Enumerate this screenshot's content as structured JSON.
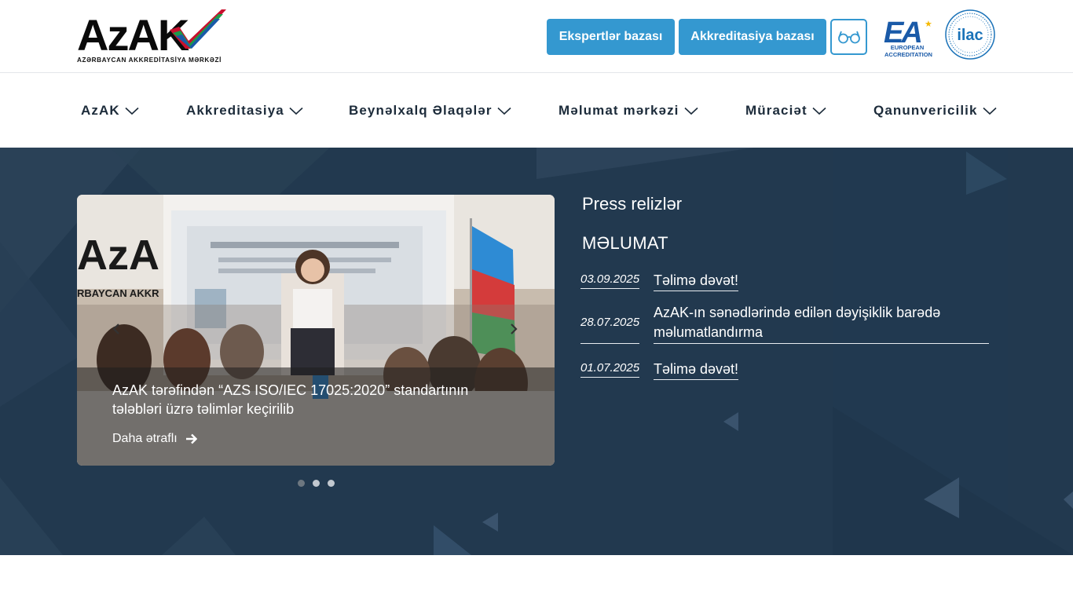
{
  "header": {
    "logo_text": "AzAK",
    "logo_subtitle": "AZƏRBAYCAN AKKREDİTASİYA MƏRKƏZİ",
    "experts_button": "Ekspertlər bazası",
    "accreditation_button": "Akkreditasiya bazası",
    "ea_logo": {
      "mark": "EA",
      "line1": "EUROPEAN",
      "line2": "ACCREDITATION"
    },
    "ilac_logo": "ilac",
    "accessibility_icon": "glasses-icon"
  },
  "nav": {
    "items": [
      {
        "label": "AzAK"
      },
      {
        "label": "Akkreditasiya"
      },
      {
        "label": "Beynəlxalq Əlaqələr"
      },
      {
        "label": "Məlumat mərkəzi"
      },
      {
        "label": "Müraciət"
      },
      {
        "label": "Qanunvericilik"
      }
    ]
  },
  "slider": {
    "title": "AzAK tərəfindən “AZS ISO/IEC 17025:2020” standartının tələbləri üzrə təlimlər keçirilib",
    "more_label": "Daha ətraflı",
    "prev_icon": "chevron-left-icon",
    "next_icon": "chevron-right-icon",
    "slide_count": 3,
    "active_index": 0
  },
  "press": {
    "title": "Press relizlər",
    "section": "MƏLUMAT",
    "items": [
      {
        "date": "03.09.2025",
        "title": "Təlimə dəvət!"
      },
      {
        "date": "28.07.2025",
        "title": "AzAK-ın sənədlərində edilən dəyişiklik barədə məlumatlandırma"
      },
      {
        "date": "01.07.2025",
        "title": "Təlimə dəvət!"
      }
    ]
  },
  "colors": {
    "primary_blue": "#3498d0",
    "hero_bg": "#22394f",
    "nav_text": "#1c2b3a",
    "ea_blue": "#1a5aa8"
  }
}
